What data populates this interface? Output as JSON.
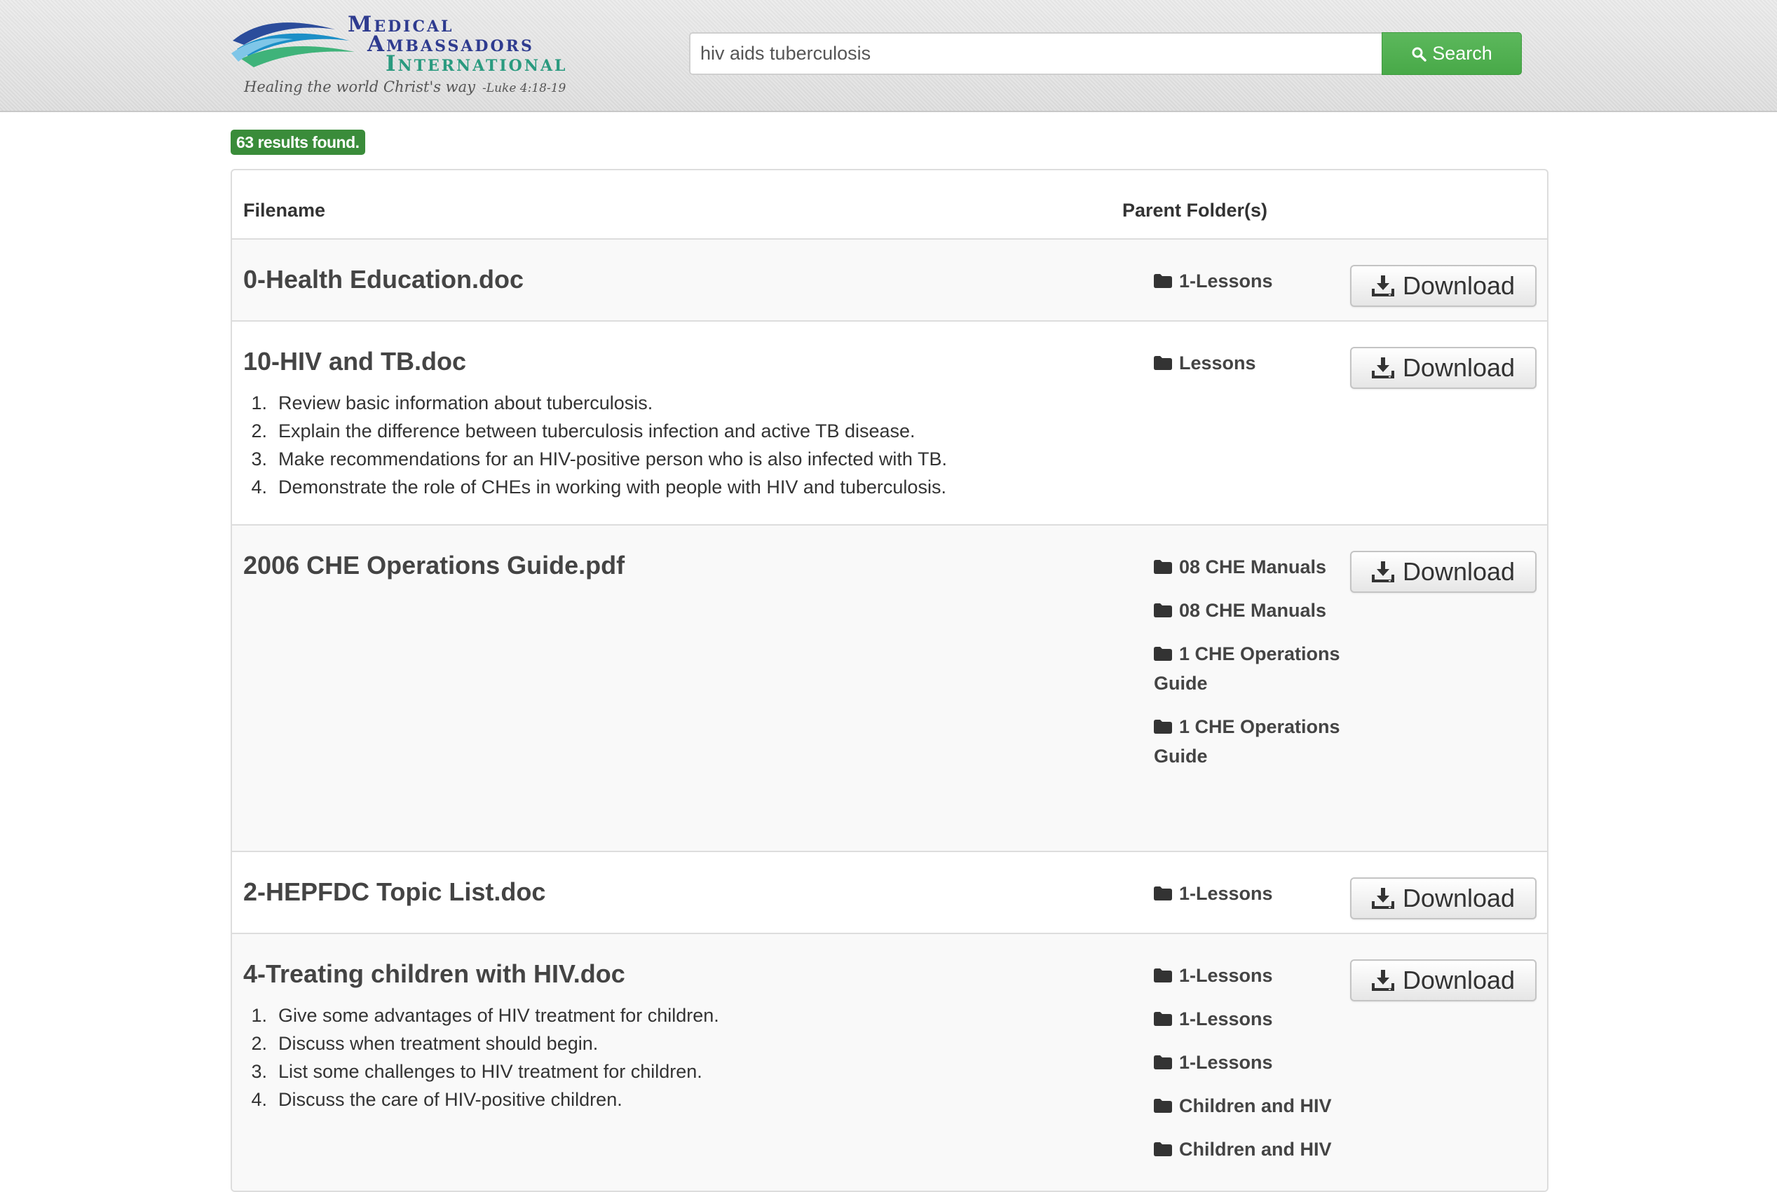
{
  "header": {
    "logo": {
      "line1": "Medical",
      "line2": "Ambassadors",
      "line3": "International",
      "tagline": "Healing the world Christ's way",
      "tagline_ref": "-Luke 4:18-19",
      "icon": "waves-logo-icon"
    },
    "search": {
      "value": "hiv aids tuberculosis",
      "button_label": "Search",
      "button_icon": "search-icon"
    }
  },
  "results_badge": "63 results found.",
  "table": {
    "headers": {
      "filename": "Filename",
      "parent_folders": "Parent Folder(s)"
    },
    "download_label": "Download",
    "rows": [
      {
        "filename": "0-Health Education.doc",
        "description": [],
        "folders": [
          "1-Lessons"
        ]
      },
      {
        "filename": "10-HIV and TB.doc",
        "description": [
          "Review basic information about tuberculosis.",
          "Explain the difference between tuberculosis infection and active TB disease.",
          "Make recommendations for an HIV-positive person who is also infected with TB.",
          "Demonstrate the role of CHEs in working with people with HIV and tuberculosis."
        ],
        "folders": [
          "Lessons"
        ]
      },
      {
        "filename": "2006 CHE Operations Guide.pdf",
        "description": [],
        "folders": [
          "08 CHE Manuals",
          "08 CHE Manuals",
          "1 CHE Operations Guide",
          "1 CHE Operations Guide"
        ]
      },
      {
        "filename": "2-HEPFDC Topic List.doc",
        "description": [],
        "folders": [
          "1-Lessons"
        ]
      },
      {
        "filename": "4-Treating children with HIV.doc",
        "description": [
          "Give some advantages of HIV treatment for children.",
          "Discuss when treatment should begin.",
          "List some challenges to HIV treatment for children.",
          "Discuss the care of HIV-positive children."
        ],
        "folders": [
          "1-Lessons",
          "1-Lessons",
          "1-Lessons",
          "Children and HIV",
          "Children and HIV"
        ]
      }
    ]
  },
  "colors": {
    "search_button": "#5cb85c",
    "badge": "#3a8c3a",
    "logo_blue": "#2e3b8f",
    "logo_green": "#2a9a7f"
  }
}
